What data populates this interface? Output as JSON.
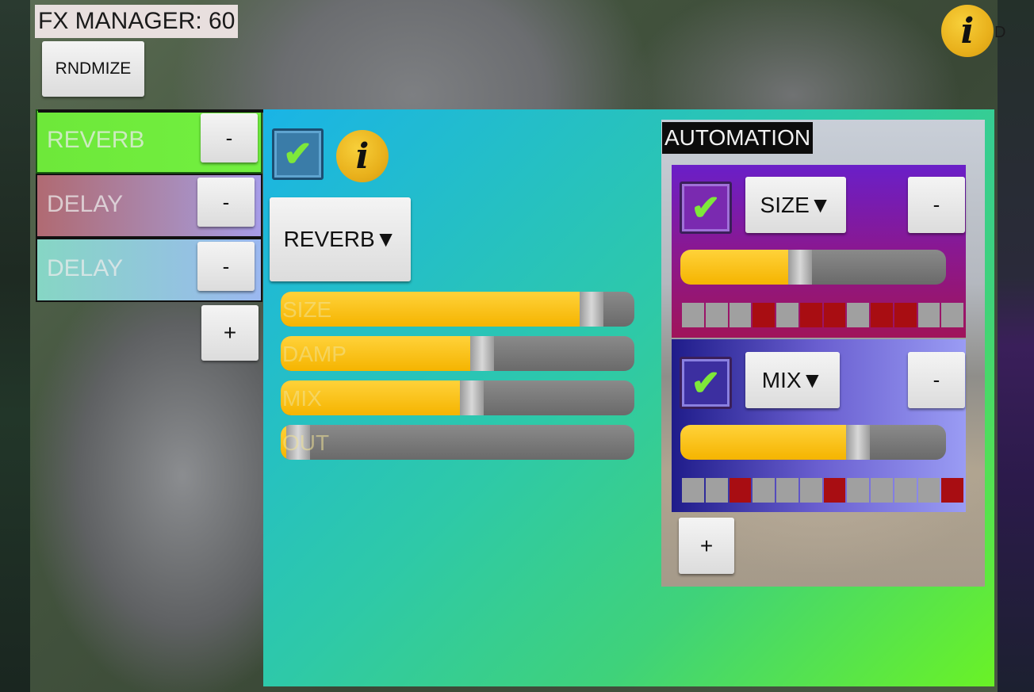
{
  "header": {
    "title": "FX MANAGER: 60",
    "randomize_label": "RNDMIZE",
    "info_glyph": "i",
    "ghost_letter": "D"
  },
  "fx_list": {
    "items": [
      {
        "label": "REVERB",
        "remove_label": "-",
        "selected": true
      },
      {
        "label": "DELAY",
        "remove_label": "-",
        "selected": false
      },
      {
        "label": "DELAY",
        "remove_label": "-",
        "selected": false
      }
    ],
    "add_label": "+"
  },
  "fx_editor": {
    "enabled": true,
    "check_glyph": "✔",
    "info_glyph": "i",
    "effect_type_label": "REVERB▼",
    "params": [
      {
        "name": "SIZE",
        "value": 0.88
      },
      {
        "name": "DAMP",
        "value": 0.57
      },
      {
        "name": "MIX",
        "value": 0.54
      },
      {
        "name": "OUT",
        "value": 0.05
      }
    ]
  },
  "automation": {
    "title": "AUTOMATION",
    "lanes": [
      {
        "enabled": true,
        "param_label": "SIZE▼",
        "remove_label": "-",
        "value": 0.45,
        "steps": [
          0,
          0,
          0,
          1,
          0,
          1,
          1,
          0,
          1,
          1,
          0,
          0
        ]
      },
      {
        "enabled": true,
        "param_label": "MIX▼",
        "remove_label": "-",
        "value": 0.67,
        "steps": [
          0,
          0,
          1,
          0,
          0,
          0,
          1,
          0,
          0,
          0,
          0,
          1
        ]
      }
    ],
    "add_label": "+"
  },
  "colors": {
    "slider_fill": "#f5b400",
    "step_on": "#a80d12",
    "step_off": "#a0a0a0",
    "check": "#7ee83a"
  }
}
